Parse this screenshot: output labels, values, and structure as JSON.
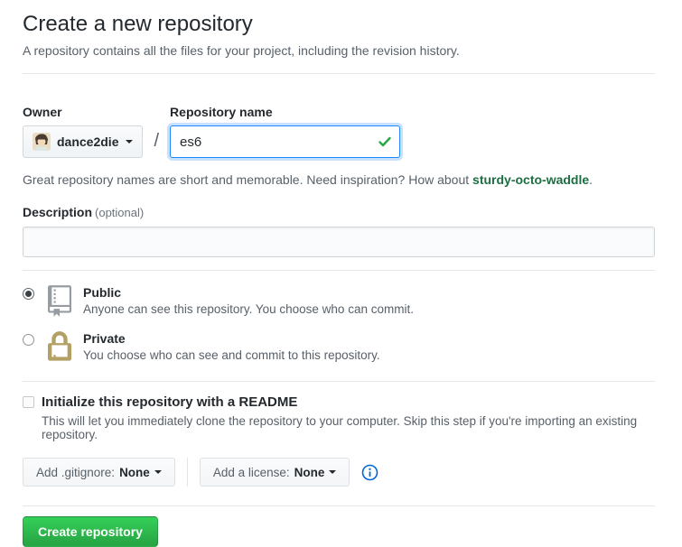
{
  "page": {
    "title": "Create a new repository",
    "subtitle": "A repository contains all the files for your project, including the revision history."
  },
  "owner": {
    "label": "Owner",
    "username": "dance2die",
    "separator": "/"
  },
  "repo_name": {
    "label": "Repository name",
    "value": "es6",
    "valid": true
  },
  "suggestion": {
    "text_before": "Great repository names are short and memorable. Need inspiration? How about ",
    "link": "sturdy-octo-waddle",
    "text_after": "."
  },
  "description": {
    "label": "Description",
    "optional": "(optional)",
    "value": ""
  },
  "visibility": {
    "public": {
      "label": "Public",
      "description": "Anyone can see this repository. You choose who can commit.",
      "selected": true
    },
    "private": {
      "label": "Private",
      "description": "You choose who can see and commit to this repository.",
      "selected": false
    }
  },
  "readme": {
    "label": "Initialize this repository with a README",
    "note": "This will let you immediately clone the repository to your computer. Skip this step if you're importing an existing repository.",
    "checked": false
  },
  "dropdowns": {
    "gitignore": {
      "prefix": "Add .gitignore:",
      "value": "None"
    },
    "license": {
      "prefix": "Add a license:",
      "value": "None"
    }
  },
  "actions": {
    "create_label": "Create repository"
  },
  "icons": {
    "check": "✓",
    "caret_down": "▾",
    "info": "ⓘ",
    "repo_book": "book-with-bookmark",
    "lock": "padlock"
  },
  "colors": {
    "accent_green": "#28a745",
    "button_green_top": "#34d058",
    "link_green": "#1d6e42",
    "focus_blue": "#2188ff",
    "info_blue": "#0366d6",
    "text_dark": "#24292e",
    "text_gray": "#586069",
    "repo_icon_gray": "#969ca2",
    "lock_icon_gold": "#b3a064"
  }
}
